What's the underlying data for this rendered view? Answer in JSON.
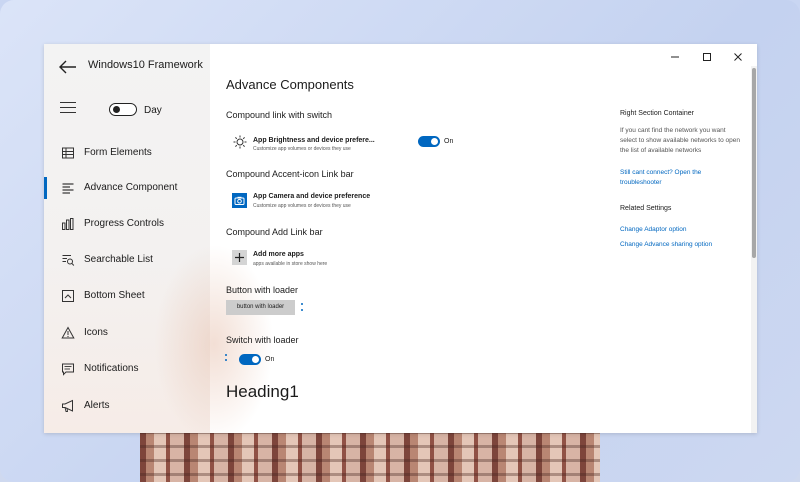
{
  "app": {
    "title": "Windows10 Framework"
  },
  "theme": {
    "label": "Day",
    "accent": "#0067c0"
  },
  "sidebar": {
    "items": [
      {
        "label": "Form Elements",
        "icon": "table-icon"
      },
      {
        "label": "Advance Component",
        "icon": "list-icon",
        "active": true
      },
      {
        "label": "Progress Controls",
        "icon": "bar-chart-icon"
      },
      {
        "label": "Searchable List",
        "icon": "search-list-icon"
      },
      {
        "label": "Bottom Sheet",
        "icon": "bottom-sheet-icon"
      },
      {
        "label": "Icons",
        "icon": "warning-icon"
      },
      {
        "label": "Notifications",
        "icon": "notification-icon"
      },
      {
        "label": "Alerts",
        "icon": "megaphone-icon"
      }
    ]
  },
  "main": {
    "title": "Advance Components",
    "switch_section": {
      "title": "Compound link with switch",
      "row_title": "App Brightness and device prefere...",
      "row_sub": "Customize app volumes or devices they use",
      "state": "On"
    },
    "accent_section": {
      "title": "Compound Accent-icon Link bar",
      "row_title": "App Camera and device preference",
      "row_sub": "Customize app volumes or devices they use"
    },
    "add_section": {
      "title": "Compound Add Link bar",
      "row_title": "Add more apps",
      "row_sub": "apps available in store show here"
    },
    "button_section": {
      "title": "Button with loader",
      "button_label": "button with loader"
    },
    "switch_loader_section": {
      "title": "Switch with loader",
      "state": "On"
    },
    "heading1": "Heading1"
  },
  "right": {
    "title": "Right Section Container",
    "text": "If you cant find the network you want select to show available networks to open the list of available networks",
    "link": "Still cant connect? Open the troubleshooter",
    "related_title": "Related Settings",
    "related_links": [
      "Change Adaptor option",
      "Change Advance sharing option"
    ]
  }
}
